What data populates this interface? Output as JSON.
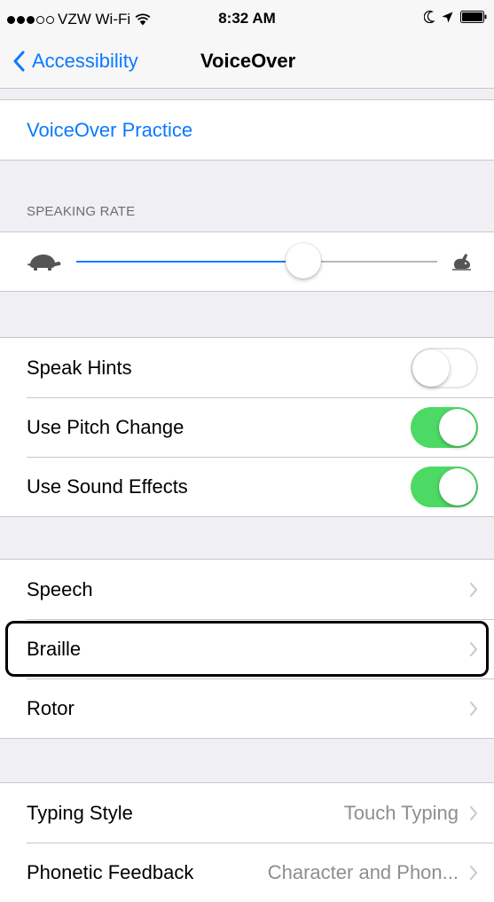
{
  "status_bar": {
    "carrier": "VZW Wi-Fi",
    "time": "8:32 AM",
    "signal_bars": 3,
    "signal_total": 5
  },
  "nav": {
    "back_label": "Accessibility",
    "title": "VoiceOver"
  },
  "practice": {
    "label": "VoiceOver Practice"
  },
  "speaking_rate": {
    "header": "SPEAKING RATE",
    "value_fraction": 0.63,
    "min_icon": "turtle-icon",
    "max_icon": "hare-icon"
  },
  "toggles": [
    {
      "label": "Speak Hints",
      "on": false
    },
    {
      "label": "Use Pitch Change",
      "on": true
    },
    {
      "label": "Use Sound Effects",
      "on": true
    }
  ],
  "nav_rows": [
    {
      "label": "Speech",
      "focused": false
    },
    {
      "label": "Braille",
      "focused": true
    },
    {
      "label": "Rotor",
      "focused": false
    }
  ],
  "detail_rows": [
    {
      "label": "Typing Style",
      "value": "Touch Typing"
    },
    {
      "label": "Phonetic Feedback",
      "value": "Character and Phon..."
    }
  ],
  "colors": {
    "accent": "#0a7aff",
    "toggle_on": "#4cd964",
    "background": "#efeff4",
    "separator": "#c8c7cc",
    "secondary_text": "#8e8e93"
  }
}
